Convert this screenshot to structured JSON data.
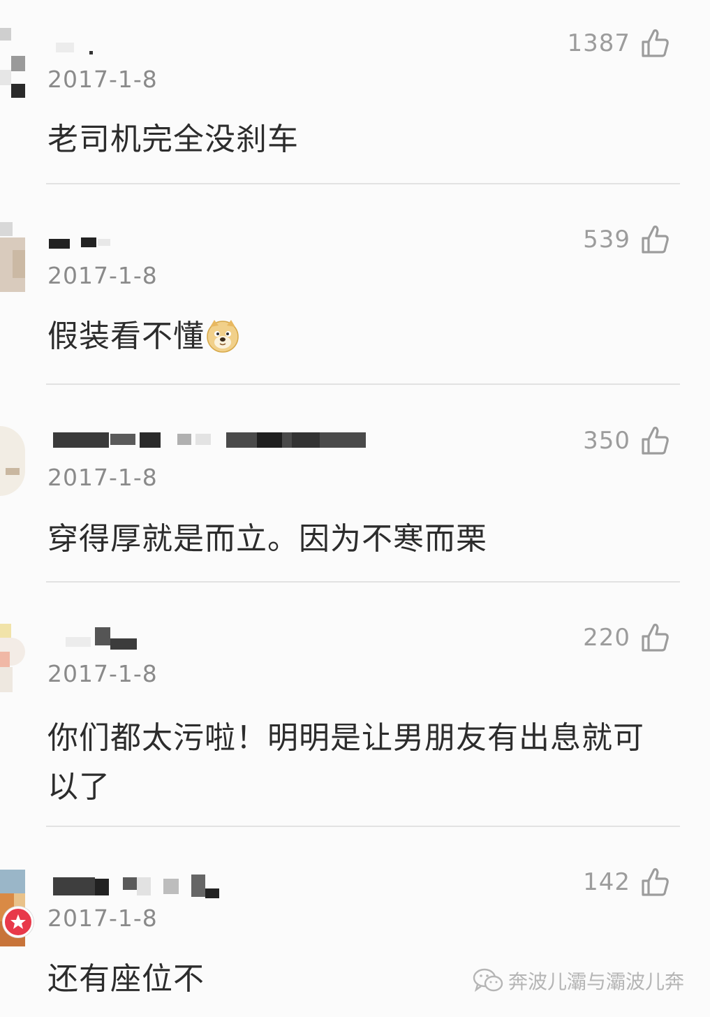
{
  "comments": [
    {
      "date": "2017-1-8",
      "likes": "1387",
      "text": "老司机完全没刹车"
    },
    {
      "date": "2017-1-8",
      "likes": "539",
      "text": "假装看不懂"
    },
    {
      "date": "2017-1-8",
      "likes": "350",
      "text": "穿得厚就是而立。因为不寒而栗"
    },
    {
      "date": "2017-1-8",
      "likes": "220",
      "text": "你们都太污啦！明明是让男朋友有出息就可以了"
    },
    {
      "date": "2017-1-8",
      "likes": "142",
      "text": "还有座位不"
    }
  ],
  "icons": {
    "like": "thumbs-up-icon",
    "emoji": "doge-emoji-icon",
    "badge": "star-badge-icon",
    "watermark": "wechat-icon"
  },
  "watermark": {
    "text": "奔波儿灞与灞波儿奔"
  },
  "colors": {
    "accent_red": "#e8394a",
    "text": "#2c2c2c",
    "meta": "#8a8a8a"
  }
}
